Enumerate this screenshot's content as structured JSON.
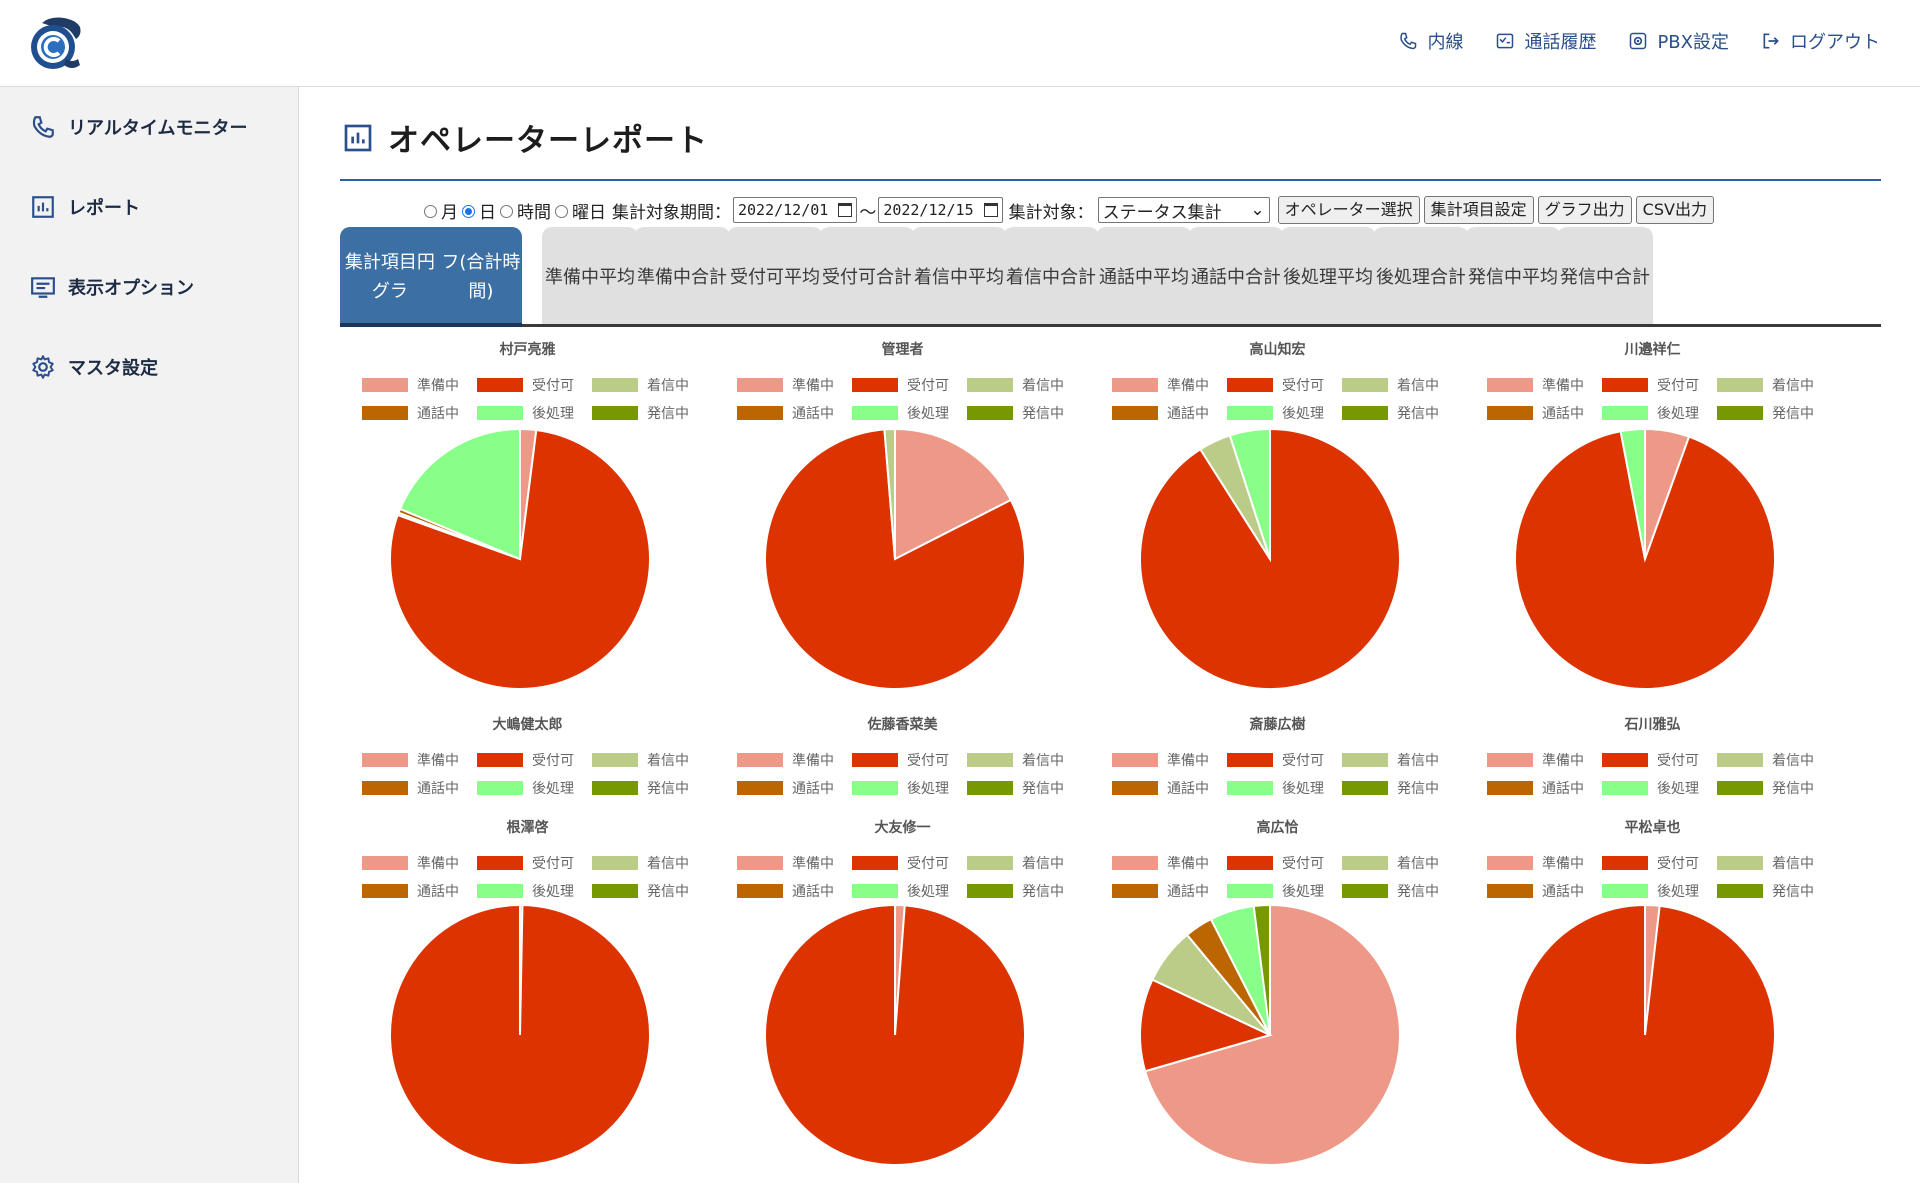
{
  "header": {
    "nav": [
      {
        "label": "内線",
        "icon": "phone-icon"
      },
      {
        "label": "通話履歴",
        "icon": "history-icon"
      },
      {
        "label": "PBX設定",
        "icon": "settings-icon"
      },
      {
        "label": "ログアウト",
        "icon": "logout-icon"
      }
    ]
  },
  "sidebar": {
    "items": [
      {
        "label": "リアルタイムモニター",
        "icon": "phone-icon"
      },
      {
        "label": "レポート",
        "icon": "report-icon"
      },
      {
        "label": "表示オプション",
        "icon": "display-options-icon"
      },
      {
        "label": "マスタ設定",
        "icon": "gear-icon"
      }
    ]
  },
  "page": {
    "title": "オペレーターレポート"
  },
  "controls": {
    "period_options": [
      "月",
      "日",
      "時間",
      "曜日"
    ],
    "selected_period": "日",
    "period_label": "集計対象期間：",
    "start_date": "2022/12/01",
    "separator": "～",
    "end_date": "2022/12/15",
    "target_label": "集計対象：",
    "target_value": "ステータス集計",
    "buttons": [
      "オペレーター選択",
      "集計項目設定",
      "グラフ出力",
      "CSV出力"
    ]
  },
  "tabs": [
    {
      "line1": "集計項目円グラ",
      "line2": "フ(合計時間)",
      "active": true
    },
    {
      "line1": "準備中",
      "line2": "平均",
      "active": false
    },
    {
      "line1": "準備中",
      "line2": "合計",
      "active": false
    },
    {
      "line1": "受付可",
      "line2": "平均",
      "active": false
    },
    {
      "line1": "受付可",
      "line2": "合計",
      "active": false
    },
    {
      "line1": "着信中",
      "line2": "平均",
      "active": false
    },
    {
      "line1": "着信中",
      "line2": "合計",
      "active": false
    },
    {
      "line1": "通話中",
      "line2": "平均",
      "active": false
    },
    {
      "line1": "通話中",
      "line2": "合計",
      "active": false
    },
    {
      "line1": "後処理",
      "line2": "平均",
      "active": false
    },
    {
      "line1": "後処理",
      "line2": "合計",
      "active": false
    },
    {
      "line1": "発信中",
      "line2": "平均",
      "active": false
    },
    {
      "line1": "発信中",
      "line2": "合計",
      "active": false
    }
  ],
  "legend": [
    {
      "label": "準備中",
      "color": "#ee9988"
    },
    {
      "label": "受付可",
      "color": "#dd3300"
    },
    {
      "label": "着信中",
      "color": "#bbcc88"
    },
    {
      "label": "通話中",
      "color": "#bb6600"
    },
    {
      "label": "後処理",
      "color": "#88ff88"
    },
    {
      "label": "発信中",
      "color": "#779900"
    }
  ],
  "chart_data": [
    {
      "type": "pie",
      "title": "村戸亮雅",
      "categories": [
        "準備中",
        "受付可",
        "着信中",
        "通話中",
        "後処理",
        "発信中"
      ],
      "values": [
        2.0,
        78.5,
        0.3,
        0.5,
        18.7,
        0
      ]
    },
    {
      "type": "pie",
      "title": "管理者",
      "categories": [
        "準備中",
        "受付可",
        "着信中",
        "通話中",
        "後処理",
        "発信中"
      ],
      "values": [
        17.5,
        81.2,
        1.3,
        0,
        0,
        0
      ]
    },
    {
      "type": "pie",
      "title": "高山知宏",
      "categories": [
        "準備中",
        "受付可",
        "着信中",
        "通話中",
        "後処理",
        "発信中"
      ],
      "values": [
        0,
        91.0,
        4.0,
        0,
        5.0,
        0
      ]
    },
    {
      "type": "pie",
      "title": "川邉祥仁",
      "categories": [
        "準備中",
        "受付可",
        "着信中",
        "通話中",
        "後処理",
        "発信中"
      ],
      "values": [
        5.5,
        91.5,
        0,
        0,
        3.0,
        0
      ]
    },
    {
      "type": "pie",
      "title": "大嶋健太郎",
      "categories": [
        "準備中",
        "受付可",
        "着信中",
        "通話中",
        "後処理",
        "発信中"
      ],
      "values": [
        0,
        0,
        0,
        0,
        0,
        0
      ]
    },
    {
      "type": "pie",
      "title": "佐藤香菜美",
      "categories": [
        "準備中",
        "受付可",
        "着信中",
        "通話中",
        "後処理",
        "発信中"
      ],
      "values": [
        0,
        0,
        0,
        0,
        0,
        0
      ]
    },
    {
      "type": "pie",
      "title": "斎藤広樹",
      "categories": [
        "準備中",
        "受付可",
        "着信中",
        "通話中",
        "後処理",
        "発信中"
      ],
      "values": [
        0,
        0,
        0,
        0,
        0,
        0
      ]
    },
    {
      "type": "pie",
      "title": "石川雅弘",
      "categories": [
        "準備中",
        "受付可",
        "着信中",
        "通話中",
        "後処理",
        "発信中"
      ],
      "values": [
        0,
        0,
        0,
        0,
        0,
        0
      ]
    },
    {
      "type": "pie",
      "title": "根澤啓",
      "categories": [
        "準備中",
        "受付可",
        "着信中",
        "通話中",
        "後処理",
        "発信中"
      ],
      "values": [
        0.3,
        99.7,
        0,
        0,
        0,
        0
      ]
    },
    {
      "type": "pie",
      "title": "大友修一",
      "categories": [
        "準備中",
        "受付可",
        "着信中",
        "通話中",
        "後処理",
        "発信中"
      ],
      "values": [
        1.2,
        98.8,
        0,
        0,
        0,
        0
      ]
    },
    {
      "type": "pie",
      "title": "高広恰",
      "categories": [
        "準備中",
        "受付可",
        "着信中",
        "通話中",
        "後処理",
        "発信中"
      ],
      "values": [
        70.5,
        11.5,
        7.0,
        3.5,
        5.5,
        2.0
      ]
    },
    {
      "type": "pie",
      "title": "平松卓也",
      "categories": [
        "準備中",
        "受付可",
        "着信中",
        "通話中",
        "後処理",
        "発信中"
      ],
      "values": [
        1.8,
        98.2,
        0,
        0,
        0,
        0
      ]
    }
  ]
}
